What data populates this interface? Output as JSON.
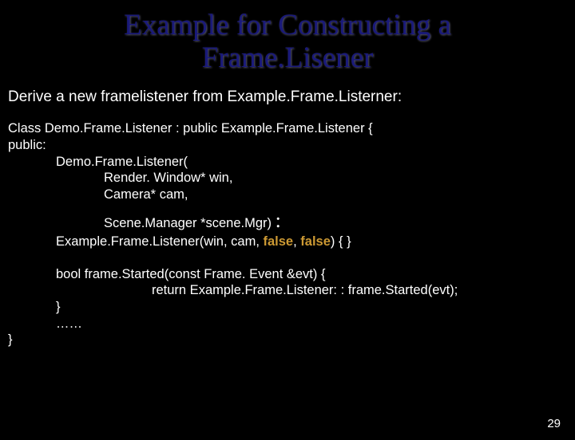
{
  "title_line1": "Example for Constructing a",
  "title_line2": "Frame.Lisener",
  "subtitle": "Derive a new framelistener from Example.Frame.Listerner:",
  "code": {
    "line1": "Class Demo.Frame.Listener : public Example.Frame.Listener {",
    "line2": "public:",
    "line3": "Demo.Frame.Listener(",
    "line4": "Render. Window* win,",
    "line5": "Camera* cam,",
    "line6a": "Scene.Manager *scene.Mgr)  ",
    "colon": ":",
    "line7a": "Example.Frame.Listener(win, cam, ",
    "false1": "false",
    "comma": ", ",
    "false2": "false",
    "line7b": ") { }",
    "line8": "bool frame.Started(const Frame. Event &evt) {",
    "line9": "return Example.Frame.Listener: : frame.Started(evt);",
    "line10": "}",
    "line11": "……",
    "line12": "}"
  },
  "pagenum": "29"
}
